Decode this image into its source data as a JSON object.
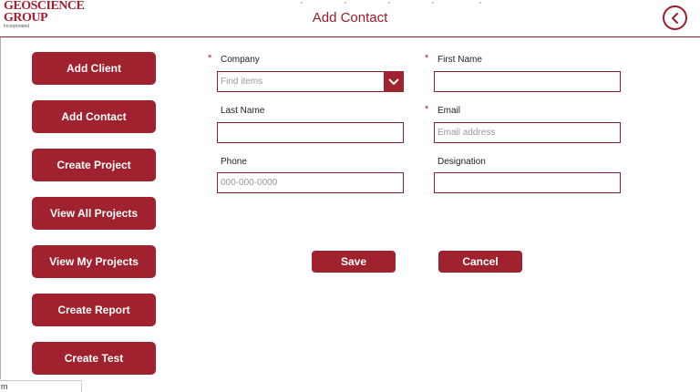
{
  "header": {
    "logo_line1": "GEOSCIENCE",
    "logo_line2": "GROUP",
    "logo_line3": "Incorporated",
    "title": "Add Contact",
    "back_icon": "chevron-left-circle-icon"
  },
  "nav": {
    "items": [
      {
        "label": "Add Client"
      },
      {
        "label": "Add Contact"
      },
      {
        "label": "Create Project"
      },
      {
        "label": "View All Projects"
      },
      {
        "label": "View My Projects"
      },
      {
        "label": "Create Report"
      },
      {
        "label": "Create Test"
      }
    ]
  },
  "form": {
    "required_marker": "*",
    "company": {
      "label": "Company",
      "placeholder": "Find items"
    },
    "first_name": {
      "label": "First Name",
      "value": ""
    },
    "last_name": {
      "label": "Last Name",
      "value": ""
    },
    "email": {
      "label": "Email",
      "placeholder": "Email address"
    },
    "phone": {
      "label": "Phone",
      "placeholder": "000-000-0000"
    },
    "designation": {
      "label": "Designation",
      "value": ""
    }
  },
  "actions": {
    "save_label": "Save",
    "cancel_label": "Cancel"
  },
  "status": {
    "text": "m"
  },
  "colors": {
    "accent": "#a1222f",
    "border": "#8f1d2c"
  }
}
